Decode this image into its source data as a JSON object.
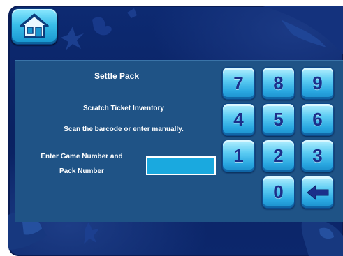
{
  "header": {
    "home_icon": "home-icon"
  },
  "panel": {
    "title": "Settle Pack",
    "subtitle": "Scratch Ticket Inventory",
    "instruction": "Scan the barcode or enter manually.",
    "prompt_line1": "Enter Game Number and",
    "prompt_line2": "Pack Number",
    "entry_value": ""
  },
  "keypad": {
    "k7": "7",
    "k8": "8",
    "k9": "9",
    "k4": "4",
    "k5": "5",
    "k6": "6",
    "k1": "1",
    "k2": "2",
    "k3": "3",
    "k0": "0",
    "backspace_icon": "left-arrow-icon"
  },
  "colors": {
    "background": "#0c276c",
    "panel": "#1f5386",
    "key": "#5cccf3",
    "key_text": "#1b2f8a",
    "entry": "#1aa9df"
  }
}
